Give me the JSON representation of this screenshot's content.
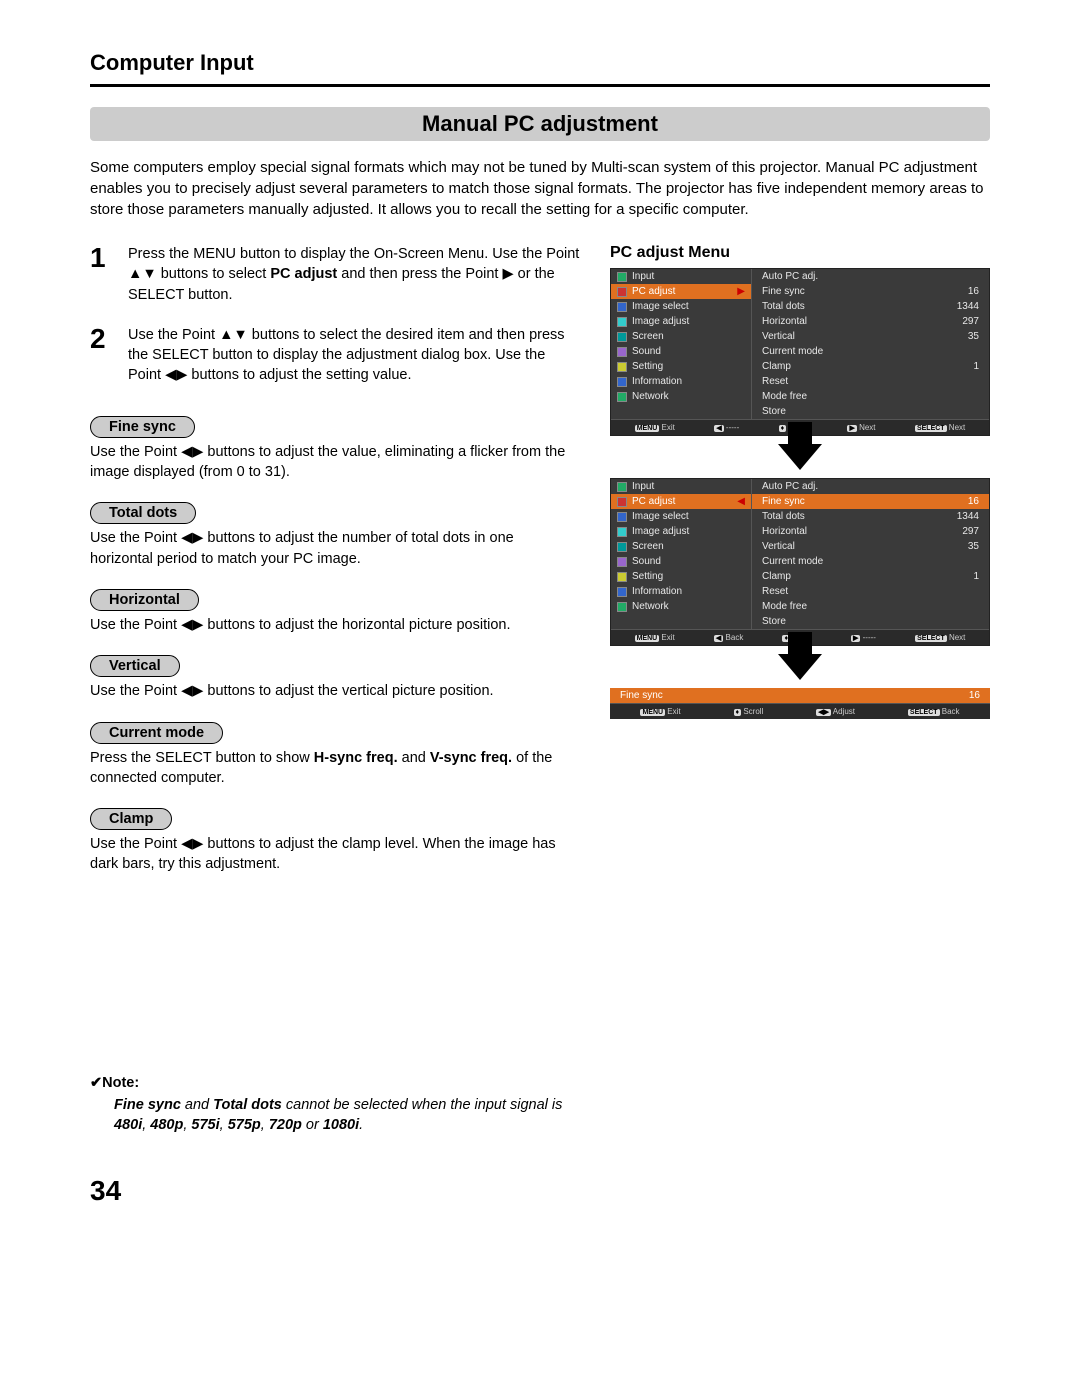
{
  "header": {
    "section": "Computer Input",
    "title": "Manual PC adjustment",
    "page_number": "34"
  },
  "intro": "Some computers employ special signal formats which may not be tuned by Multi-scan system of this projector. Manual PC adjustment enables you to precisely adjust several parameters to match those signal formats. The projector has five independent memory areas to store those parameters manually adjusted. It allows you to recall the setting for a specific computer.",
  "steps": [
    {
      "num": "1",
      "text_pre": "Press the MENU button to display the On-Screen Menu. Use the Point ▲▼ buttons to select ",
      "bold": "PC adjust",
      "text_post": " and then press the Point ▶ or the SELECT button."
    },
    {
      "num": "2",
      "text_pre": "Use the Point ▲▼ buttons to select the desired item and then press the SELECT button to display the adjustment dialog box. Use the Point ◀▶ buttons to adjust the setting value.",
      "bold": "",
      "text_post": ""
    }
  ],
  "params": [
    {
      "label": "Fine sync",
      "desc": "Use the Point ◀▶ buttons to adjust the value, eliminating a flicker from the image displayed (from 0 to 31)."
    },
    {
      "label": "Total dots",
      "desc": "Use the Point ◀▶ buttons to adjust the number of total dots in one horizontal period to match your PC image."
    },
    {
      "label": "Horizontal",
      "desc": "Use the Point ◀▶ buttons to adjust the horizontal picture position."
    },
    {
      "label": "Vertical",
      "desc": "Use the Point ◀▶ buttons to adjust the vertical picture position."
    },
    {
      "label": "Current mode",
      "desc_pre": "Press the SELECT button to show ",
      "bold1": "H-sync freq.",
      "mid": " and ",
      "bold2": "V-sync freq.",
      "desc_post": " of the connected computer."
    },
    {
      "label": "Clamp",
      "desc": "Use the Point ◀▶ buttons to adjust the clamp level. When the image has dark bars, try this adjustment."
    }
  ],
  "right": {
    "heading": "PC adjust Menu"
  },
  "osd1": {
    "left_items": [
      "Input",
      "PC adjust",
      "Image select",
      "Image adjust",
      "Screen",
      "Sound",
      "Setting",
      "Information",
      "Network"
    ],
    "selected_left_index": 1,
    "right_items": [
      {
        "label": "Auto PC adj.",
        "value": ""
      },
      {
        "label": "Fine sync",
        "value": "16"
      },
      {
        "label": "Total dots",
        "value": "1344"
      },
      {
        "label": "Horizontal",
        "value": "297"
      },
      {
        "label": "Vertical",
        "value": "35"
      },
      {
        "label": "Current mode",
        "value": ""
      },
      {
        "label": "Clamp",
        "value": "1"
      },
      {
        "label": "Reset",
        "value": ""
      },
      {
        "label": "Mode free",
        "value": ""
      },
      {
        "label": "Store",
        "value": ""
      }
    ],
    "hints": [
      {
        "key": "MENU",
        "label": "Exit"
      },
      {
        "key": "◀",
        "label": "-----"
      },
      {
        "key": "♦",
        "label": "Move"
      },
      {
        "key": "▶",
        "label": "Next"
      },
      {
        "key": "SELECT",
        "label": "Next"
      }
    ]
  },
  "osd2": {
    "left_items": [
      "Input",
      "PC adjust",
      "Image select",
      "Image adjust",
      "Screen",
      "Sound",
      "Setting",
      "Information",
      "Network"
    ],
    "selected_left_index": 1,
    "right_items": [
      {
        "label": "Auto PC adj.",
        "value": ""
      },
      {
        "label": "Fine sync",
        "value": "16"
      },
      {
        "label": "Total dots",
        "value": "1344"
      },
      {
        "label": "Horizontal",
        "value": "297"
      },
      {
        "label": "Vertical",
        "value": "35"
      },
      {
        "label": "Current mode",
        "value": ""
      },
      {
        "label": "Clamp",
        "value": "1"
      },
      {
        "label": "Reset",
        "value": ""
      },
      {
        "label": "Mode free",
        "value": ""
      },
      {
        "label": "Store",
        "value": ""
      }
    ],
    "selected_right_index": 1,
    "hints": [
      {
        "key": "MENU",
        "label": "Exit"
      },
      {
        "key": "◀",
        "label": "Back"
      },
      {
        "key": "♦",
        "label": "Move"
      },
      {
        "key": "▶",
        "label": "-----"
      },
      {
        "key": "SELECT",
        "label": "Next"
      }
    ]
  },
  "adjust": {
    "label": "Fine sync",
    "value": "16",
    "hints": [
      {
        "key": "MENU",
        "label": "Exit"
      },
      {
        "key": "♦",
        "label": "Scroll"
      },
      {
        "key": "◀▶",
        "label": "Adjust"
      },
      {
        "key": "SELECT",
        "label": "Back"
      }
    ]
  },
  "note": {
    "title": "✔Note:",
    "body_pre": "",
    "b1": "Fine sync",
    "m1": " and ",
    "b2": "Total dots",
    "m2": " cannot be selected when the input signal is ",
    "b3": "480i",
    "c1": ", ",
    "b4": "480p",
    "c2": ", ",
    "b5": "575i",
    "c3": ", ",
    "b6": "575p",
    "c4": ", ",
    "b7": "720p",
    "c5": " or ",
    "b8": "1080i",
    "end": "."
  }
}
